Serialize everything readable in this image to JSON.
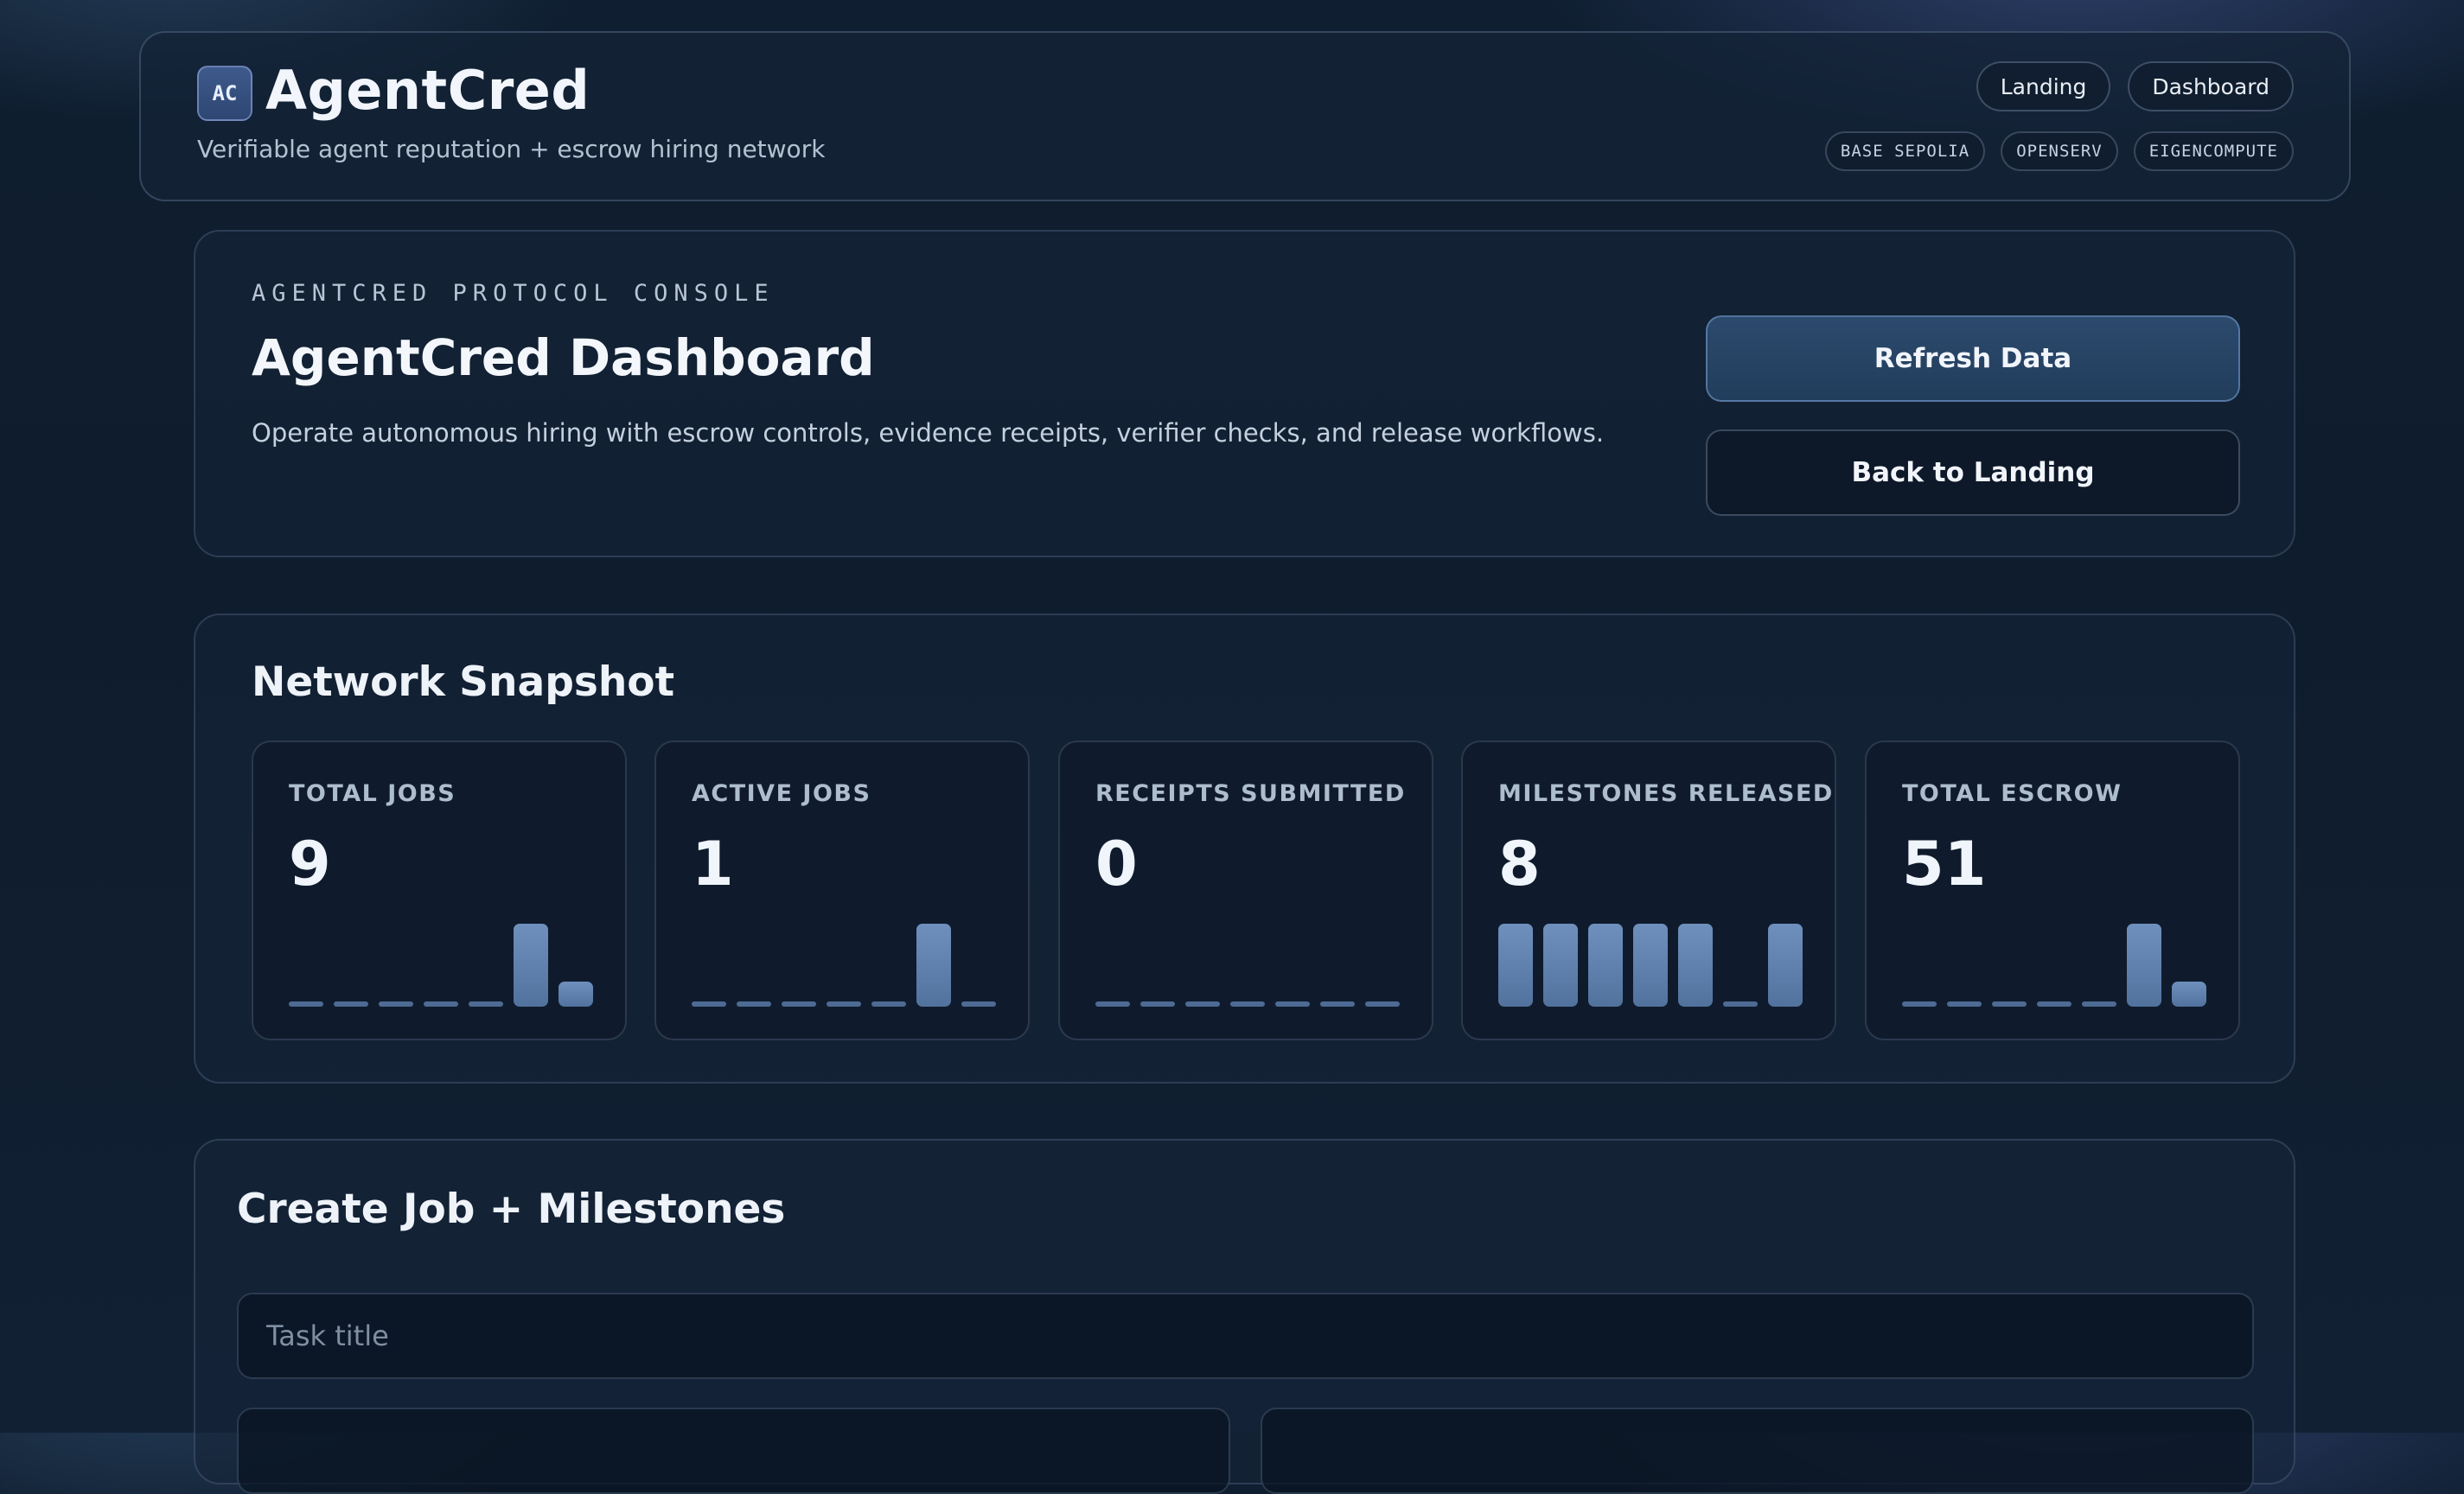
{
  "header": {
    "logo_text": "AC",
    "brand": "AgentCred",
    "tagline": "Verifiable agent reputation + escrow hiring network",
    "nav": [
      "Landing",
      "Dashboard"
    ],
    "chips": [
      "BASE SEPOLIA",
      "OPENSERV",
      "EIGENCOMPUTE"
    ]
  },
  "hero": {
    "eyebrow": "AGENTCRED PROTOCOL CONSOLE",
    "title": "AgentCred Dashboard",
    "description": "Operate autonomous hiring with escrow controls, evidence receipts, verifier checks, and release workflows.",
    "refresh_label": "Refresh Data",
    "back_label": "Back to Landing"
  },
  "snapshot": {
    "title": "Network Snapshot",
    "stats": [
      {
        "label": "TOTAL JOBS",
        "value": "9",
        "bars": [
          0,
          0,
          0,
          0,
          0,
          1,
          0.3
        ]
      },
      {
        "label": "ACTIVE JOBS",
        "value": "1",
        "bars": [
          0,
          0,
          0,
          0,
          0,
          1,
          0
        ]
      },
      {
        "label": "RECEIPTS SUBMITTED",
        "value": "0",
        "bars": [
          0,
          0,
          0,
          0,
          0,
          0,
          0
        ]
      },
      {
        "label": "MILESTONES RELEASED",
        "value": "8",
        "bars": [
          1,
          1,
          1,
          1,
          1,
          0,
          1
        ]
      },
      {
        "label": "TOTAL ESCROW",
        "value": "51",
        "bars": [
          0,
          0,
          0,
          0,
          0,
          1,
          0.3
        ]
      }
    ]
  },
  "create": {
    "title": "Create Job + Milestones",
    "task_placeholder": "Task title"
  },
  "colors": {
    "background": "#0f1c2d",
    "accent": "#2c4a6d",
    "bar": "#6f90bd"
  }
}
